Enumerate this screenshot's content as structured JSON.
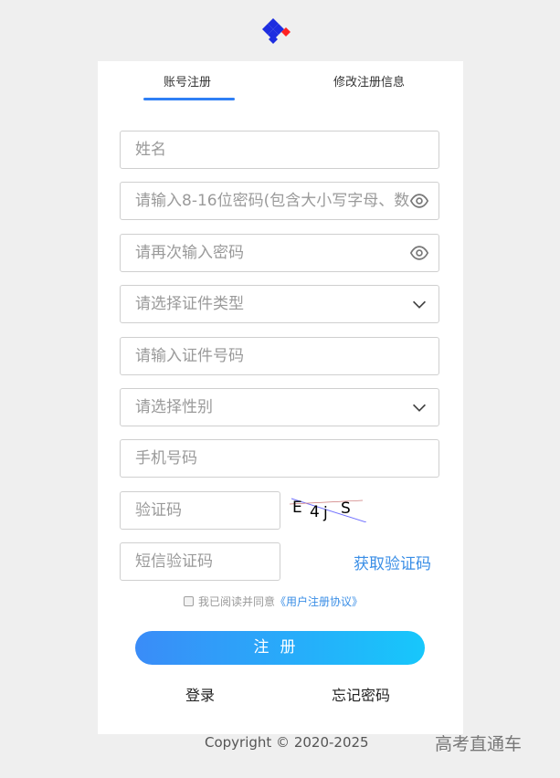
{
  "logo": {
    "icon": "diamond-logo-icon",
    "colors": [
      "#1d2de0",
      "#ff2222"
    ]
  },
  "tabs": [
    {
      "label": "账号注册",
      "active": true
    },
    {
      "label": "修改注册信息",
      "active": false
    }
  ],
  "form": {
    "name": {
      "placeholder": "姓名"
    },
    "password": {
      "placeholder": "请输入8-16位密码(包含大小写字母、数字",
      "icon": "eye-icon"
    },
    "password_confirm": {
      "placeholder": "请再次输入密码",
      "icon": "eye-icon"
    },
    "id_type": {
      "placeholder": "请选择证件类型",
      "icon": "chevron-down-icon"
    },
    "id_number": {
      "placeholder": "请输入证件号码"
    },
    "gender": {
      "placeholder": "请选择性别",
      "icon": "chevron-down-icon"
    },
    "phone": {
      "placeholder": "手机号码"
    },
    "captcha": {
      "placeholder": "验证码",
      "image_text": "E4jS"
    },
    "sms_code": {
      "placeholder": "短信验证码"
    },
    "sms_link": "获取验证码"
  },
  "agreement": {
    "text": "我已阅读并同意",
    "link": "《用户注册协议》",
    "checked": false
  },
  "register_button": "注册",
  "links": {
    "login": "登录",
    "forgot": "忘记密码"
  },
  "footer": {
    "copyright": "Copyright © 2020-2025",
    "watermark": "高考直通车"
  },
  "colors": {
    "accent": "#2f7ff5",
    "link": "#3a8ee6",
    "button_start": "#3a8cf8",
    "button_end": "#17c7fb"
  }
}
